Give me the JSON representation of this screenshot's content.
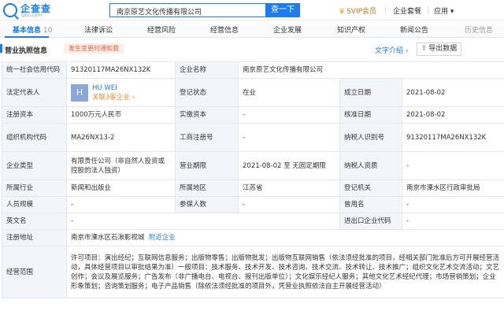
{
  "header": {
    "logo_text": "企查查",
    "logo_sub": "Qcc.com",
    "search_value": "南京原艺文化传播有限公司",
    "search_button": "查一下",
    "svip": "SVIP会员",
    "suite": "企业套餐",
    "apps": "应用",
    "apps_arrow": "▾"
  },
  "tabs": [
    {
      "label": "基本信息",
      "count": "10"
    },
    {
      "label": "法律诉讼"
    },
    {
      "label": "经营风险"
    },
    {
      "label": "经营信息"
    },
    {
      "label": "企业发展"
    },
    {
      "label": "知识产权"
    },
    {
      "label": "新闻公告"
    },
    {
      "label": "历史信息"
    }
  ],
  "section": {
    "title": "营业执照信息",
    "change_badge": "发生变更时通知我",
    "text_version": "文字介绍 ›",
    "export": "导出数据"
  },
  "table": {
    "credit_code_label": "统一社会信用代码",
    "credit_code": "91320117MA26NX132K",
    "company_name_label": "企业名称",
    "company_name": "南京原艺文化传播有限公司",
    "legal_rep_label": "法定代表人",
    "legal_rep_avatar": "H",
    "legal_rep_name": "HU WEI",
    "legal_rep_related": "关联3家企业 ›",
    "reg_status_label": "登记状态",
    "reg_status": "在业",
    "established_label": "成立日期",
    "established": "2021-08-02",
    "reg_capital_label": "注册资本",
    "reg_capital": "1000万元人民币",
    "paid_capital_label": "实缴资本",
    "paid_capital": "-",
    "approval_date_label": "核准日期",
    "approval_date": "2021-08-02",
    "org_code_label": "组织机构代码",
    "org_code": "MA26NX13-2",
    "biz_reg_no_label": "工商注册号",
    "biz_reg_no": "-",
    "taxpayer_id_label": "纳税人识别号",
    "taxpayer_id": "91320117MA26NX132K",
    "company_type_label": "企业类型",
    "company_type": "有限责任公司（非自然人投资或控股的法人独资）",
    "biz_term_label": "营业期限",
    "biz_term": "2021-08-02 至 无固定期限",
    "taxpayer_qual_label": "纳税人资质",
    "taxpayer_qual": "-",
    "industry_label": "所属行业",
    "industry": "新闻和出版业",
    "region_label": "所属地区",
    "region": "江苏省",
    "reg_authority_label": "登记机关",
    "reg_authority": "南京市溧水区行政审批局",
    "staff_size_label": "人员规模",
    "staff_size": "-",
    "insured_label": "参保人数",
    "insured": "-",
    "former_name_label": "曾用名",
    "former_name": "-",
    "english_name_label": "英文名",
    "english_name": "-",
    "import_export_label": "进出口企业代码",
    "import_export": "-",
    "address_label": "注册地址",
    "address": "南京市溧水区石湫影视城",
    "nearby": "附近企业",
    "scope_label": "经营范围",
    "scope": "许可项目：演出经纪；互联网信息服务；出版物零售；出版物批发；出版物互联网销售（依法须经批准的项目，经相关部门批准后方可开展经营活动，具体经营项目以审批结果为准）一般项目：技术服务、技术开发、技术咨询、技术交流、技术转让、技术推广；组织文化艺术交流活动；文艺创作；会议及展览服务；广告发布（非广播电台、电视台、报刊出版单位）；文化娱乐经纪人服务；其他文化艺术经纪代理；市场营销策划；企业形象策划；咨询策划服务；电子产品销售（除依法须经批准的项目外，凭营业执照依法自主开展经营活动）"
  }
}
